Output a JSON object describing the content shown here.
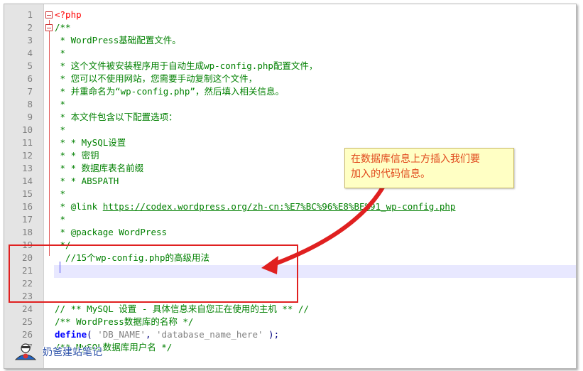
{
  "editor": {
    "line_numbers": [
      "1",
      "2",
      "3",
      "4",
      "5",
      "6",
      "7",
      "8",
      "9",
      "10",
      "11",
      "12",
      "13",
      "14",
      "15",
      "16",
      "17",
      "18",
      "19",
      "20",
      "21",
      "22",
      "23",
      "24",
      "25",
      "26",
      "27"
    ],
    "lines": {
      "l1": "<?php",
      "l2": "/**",
      "l3": " * WordPress基础配置文件。",
      "l4": " *",
      "l5": " * 这个文件被安装程序用于自动生成wp-config.php配置文件，",
      "l6": " * 您可以不使用网站，您需要手动复制这个文件，",
      "l7": " * 并重命名为“wp-config.php”，然后填入相关信息。",
      "l8": " *",
      "l9": " * 本文件包含以下配置选项：",
      "l10": " *",
      "l11": " * * MySQL设置",
      "l12": " * * 密钥",
      "l13": " * * 数据库表名前缀",
      "l14": " * * ABSPATH",
      "l15": " *",
      "l16_prefix": " * @link ",
      "l16_link": "https://codex.wordpress.org/zh-cn:%E7%BC%96%E8%BE%91_wp-config.php",
      "l17": " *",
      "l18": " * @package WordPress",
      "l19": " */",
      "l20": "  //15个wp-config.php的高级用法",
      "l21": "",
      "l22": "",
      "l23": "",
      "l24": "// ** MySQL 设置 - 具体信息来自您正在使用的主机 ** //",
      "l25": "/** WordPress数据库的名称 */",
      "l26_kw": "define",
      "l26_open": "( ",
      "l26_arg1": "'DB_NAME'",
      "l26_comma": ", ",
      "l26_arg2": "'database_name_here'",
      "l26_close": " );",
      "l27": "/** MySQL数据库用户名 */"
    }
  },
  "annotation": {
    "callout_line1": "在数据库信息上方插入我们要",
    "callout_line2": "加入的代码信息。",
    "box_color": "#e02020",
    "arrow_color": "#e02020"
  },
  "watermark": {
    "text": "奶爸建站笔记",
    "icon": "avatar-icon"
  },
  "colors": {
    "comment": "#008000",
    "php_tag": "#ff0000",
    "keyword": "#0000ff",
    "string": "#808080",
    "current_line": "#e8e8ff"
  }
}
